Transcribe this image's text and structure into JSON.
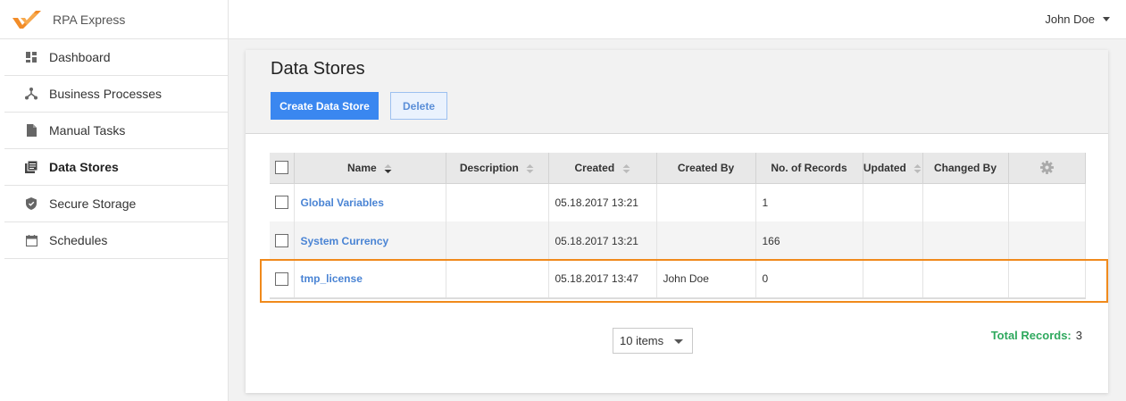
{
  "app": {
    "name": "RPA Express"
  },
  "user": {
    "name": "John Doe"
  },
  "nav": [
    {
      "label": "Dashboard",
      "icon": "dashboard-icon"
    },
    {
      "label": "Business Processes",
      "icon": "process-icon"
    },
    {
      "label": "Manual Tasks",
      "icon": "document-icon"
    },
    {
      "label": "Data Stores",
      "icon": "data-stores-icon",
      "active": true
    },
    {
      "label": "Secure Storage",
      "icon": "shield-icon"
    },
    {
      "label": "Schedules",
      "icon": "calendar-icon"
    }
  ],
  "page": {
    "title": "Data Stores",
    "create_label": "Create Data Store",
    "delete_label": "Delete"
  },
  "table": {
    "columns": [
      "Name",
      "Description",
      "Created",
      "Created By",
      "No. of Records",
      "Updated",
      "Changed By"
    ],
    "rows": [
      {
        "name": "Global Variables",
        "description": "",
        "created": "05.18.2017 13:21",
        "created_by": "",
        "records": "1",
        "updated": "",
        "changed_by": ""
      },
      {
        "name": "System Currency",
        "description": "",
        "created": "05.18.2017 13:21",
        "created_by": "",
        "records": "166",
        "updated": "",
        "changed_by": ""
      },
      {
        "name": "tmp_license",
        "description": "",
        "created": "05.18.2017 13:47",
        "created_by": "John Doe",
        "records": "0",
        "updated": "",
        "changed_by": ""
      }
    ]
  },
  "pager": {
    "page_size": "10 items"
  },
  "footer": {
    "total_label": "Total Records:",
    "total_value": "3"
  },
  "colors": {
    "accent": "#3a87f0",
    "link": "#4a84d4",
    "highlight": "#f08a1c",
    "total": "#2fa95e",
    "logo": "#f28c28"
  }
}
